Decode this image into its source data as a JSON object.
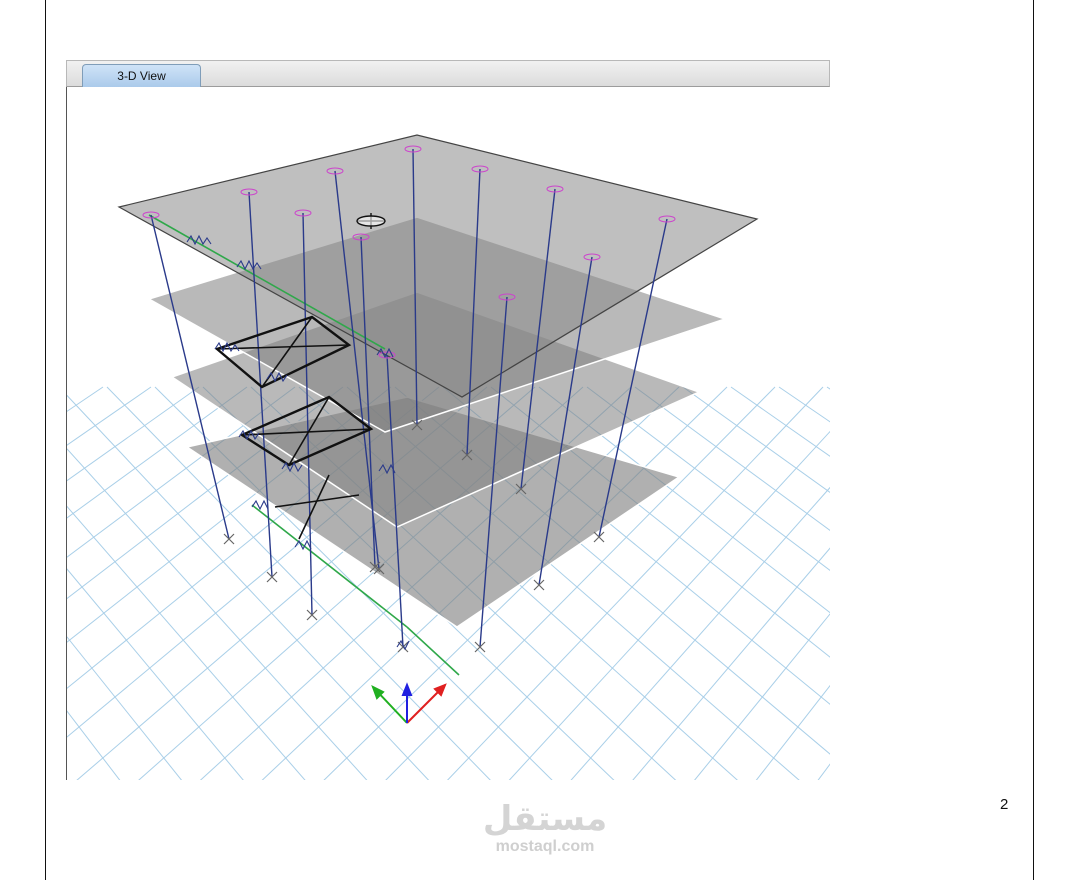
{
  "document": {
    "page_number": "2"
  },
  "window": {
    "tabs": [
      {
        "label": "3-D View",
        "active": true
      }
    ]
  },
  "model_view": {
    "grid_color": "#a9cfe8",
    "slab_color": "#7f7f7f",
    "column_color": "#2a3a8a",
    "support_color": "#cc44cc",
    "axes": {
      "x_color": "#e02020",
      "y_color": "#20b020",
      "z_color": "#2020e0"
    }
  },
  "watermark": {
    "arabic": "مستقل",
    "latin": "mostaql.com"
  }
}
